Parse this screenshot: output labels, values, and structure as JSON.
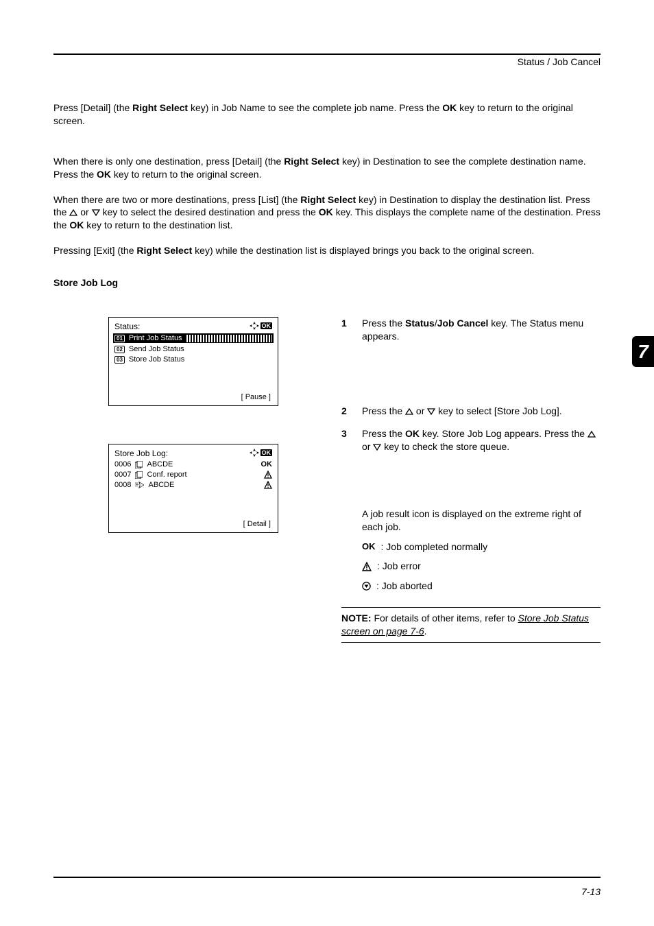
{
  "header": {
    "section_title": "Status / Job Cancel"
  },
  "page_number": "7-13",
  "tab_label": "7",
  "paragraphs": {
    "p1_a": "Press [Detail] (the ",
    "p1_b": "Right Select",
    "p1_c": " key) in Job Name to see the complete job name. Press the ",
    "p1_d": "OK",
    "p1_e": " key to return to the original screen.",
    "p2_a": "When there is only one destination, press [Detail] (the ",
    "p2_b": "Right Select",
    "p2_c": " key) in Destination to see the complete destination name. Press the ",
    "p2_d": "OK",
    "p2_e": " key to return to the original screen.",
    "p3_a": "When there are two or more destinations, press [List] (the ",
    "p3_b": "Right Select",
    "p3_c": " key) in Destination to display the destination list. Press the ",
    "p3_d": " or ",
    "p3_e": " key to select the desired destination and press the ",
    "p3_f": "OK",
    "p3_g": " key. This displays the complete name of the destination. Press the ",
    "p3_h": "OK",
    "p3_i": " key to return to the destination list.",
    "p4_a": "Pressing [Exit] (the ",
    "p4_b": "Right Select",
    "p4_c": " key) while the destination list is displayed brings you back to the original screen."
  },
  "heading_store": "Store Job Log",
  "panel1": {
    "title": "Status:",
    "item1": "Print Job Status",
    "item2": "Send Job Status",
    "item3": "Store Job Status",
    "softkey": "[  Pause  ]"
  },
  "panel2": {
    "title": "Store Job Log:",
    "r1_num": "0006",
    "r1_name": "ABCDE",
    "r2_num": "0007",
    "r2_name": "Conf. report",
    "r3_num": "0008",
    "r3_name": "ABCDE",
    "softkey": "[  Detail  ]"
  },
  "steps": {
    "s1_a": "Press the ",
    "s1_b": "Status",
    "s1_c": "/",
    "s1_d": "Job Cancel",
    "s1_e": " key. The Status menu appears.",
    "s2": "Press the ",
    "s2_b": " or ",
    "s2_c": " key to select [Store Job Log].",
    "s3_a": "Press the ",
    "s3_b": "OK",
    "s3_c": " key. Store Job Log appears. Press the ",
    "s3_d": " or ",
    "s3_e": " key to check the store queue.",
    "s4_a": "A job result icon is displayed on the extreme right of each job.",
    "r_ok": " : Job completed normally",
    "r_err": " : Job error",
    "r_abort": " : Job aborted"
  },
  "note": {
    "label": "NOTE:",
    "text_a": " For details of other items, refer to ",
    "link": "Store Job Status screen on page 7-6",
    "text_b": "."
  }
}
